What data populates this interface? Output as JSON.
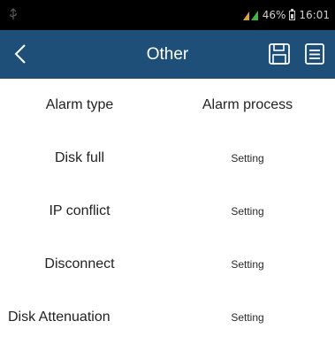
{
  "status_bar": {
    "battery_text": "46%",
    "time": "16:01",
    "signal_icon": "signal-icon",
    "battery_icon": "battery-icon"
  },
  "nav": {
    "title": "Other",
    "back_icon": "chevron-left-icon",
    "save_icon": "save-icon",
    "menu_icon": "list-icon",
    "bar_color": "#1d4f78"
  },
  "table": {
    "header": {
      "type": "Alarm type",
      "process": "Alarm process"
    },
    "rows": [
      {
        "type": "Disk full",
        "process": "Setting"
      },
      {
        "type": "IP conflict",
        "process": "Setting"
      },
      {
        "type": "Disconnect",
        "process": "Setting"
      },
      {
        "type": "Disk Attenuation",
        "process": "Setting"
      }
    ]
  }
}
